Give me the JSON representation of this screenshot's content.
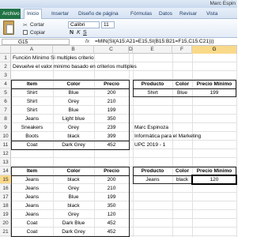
{
  "window": {
    "title": "Marc Espin"
  },
  "ribbon_tabs": [
    "Archivo",
    "Inicio",
    "Insertar",
    "Diseño de página",
    "Fórmulas",
    "Datos",
    "Revisar",
    "Vista"
  ],
  "ribbon": {
    "paste_label": "Pegar",
    "cut_label": "Cortar",
    "copy_label": "Copiar",
    "font_name": "Calibri",
    "font_size": "11",
    "bold": "N",
    "italic": "K",
    "underline": "S"
  },
  "formula_bar": {
    "name_box": "G15",
    "fx": "fx",
    "formula": "=MIN(SI(A15:A21=E15,SI(B15:B21=F15,C15:C21)))"
  },
  "columns": [
    "A",
    "B",
    "C",
    "D",
    "E",
    "F",
    "G"
  ],
  "selected_column": "G",
  "rows": [
    "1",
    "2",
    "3",
    "4",
    "5",
    "6",
    "7",
    "8",
    "9",
    "10",
    "11",
    "12",
    "13",
    "14",
    "15",
    "16",
    "17",
    "18",
    "19",
    "20",
    "21"
  ],
  "selected_row": "15",
  "sheet": {
    "title": "Función Mínimo Si multiples criterio",
    "subtitle": "Devuelve el valor minimo basado en criterios multiples",
    "table1": {
      "headers": [
        "Item",
        "Color",
        "Precio"
      ],
      "rows": [
        [
          "Shirt",
          "Blue",
          "200"
        ],
        [
          "Shirt",
          "Grey",
          "210"
        ],
        [
          "Shirt",
          "Blue",
          "199"
        ],
        [
          "Jeans",
          "Light blue",
          "350"
        ],
        [
          "Sneakers",
          "Grey",
          "239"
        ],
        [
          "Boots",
          "black",
          "399"
        ],
        [
          "Coat",
          "Dark Grey",
          "452"
        ]
      ]
    },
    "lookup1": {
      "headers": [
        "Producto",
        "Color",
        "Precio Mínimo"
      ],
      "values": [
        "Shirt",
        "Blue",
        "199"
      ]
    },
    "author": {
      "name": "Marc Espinoza",
      "course": "Informática para el Marketing",
      "term": "UPC 2019 - 1"
    },
    "table2": {
      "headers": [
        "Item",
        "Color",
        "Precio"
      ],
      "rows": [
        [
          "Jeans",
          "black",
          "200"
        ],
        [
          "Jeans",
          "Grey",
          "210"
        ],
        [
          "Jeans",
          "Blue",
          "199"
        ],
        [
          "Jeans",
          "black",
          "350"
        ],
        [
          "Jeans",
          "Grey",
          "120"
        ],
        [
          "Coat",
          "Dark Blue",
          "452"
        ],
        [
          "Coat",
          "Dark Grey",
          "452"
        ]
      ]
    },
    "lookup2": {
      "headers": [
        "Producto",
        "Color",
        "Precio Minimo"
      ],
      "values": [
        "Jeans",
        "black",
        "120"
      ]
    }
  }
}
